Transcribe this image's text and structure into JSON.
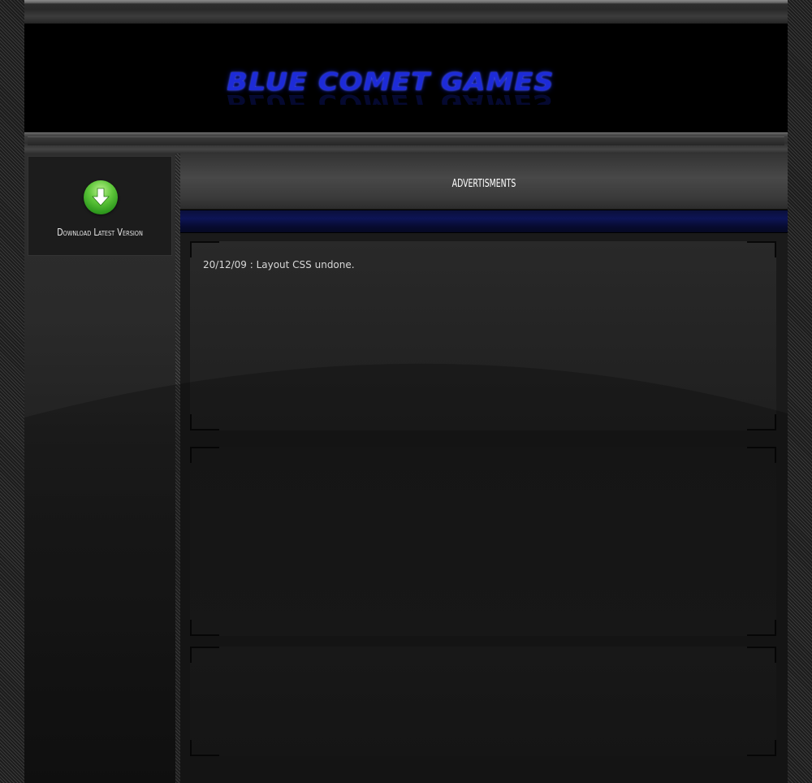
{
  "header": {
    "logo_text": "BLUE COMET GAMES"
  },
  "sidebar": {
    "download": {
      "label": "Download Latest Version",
      "icon": "download-arrow-icon",
      "icon_color": "#3fae27"
    }
  },
  "main": {
    "ad_bar": {
      "label": "ADVERTISMENTS"
    },
    "news": [
      {
        "text": "20/12/09 : Layout CSS undone."
      }
    ]
  },
  "colors": {
    "brand_blue": "#1d2bd8",
    "accent_bar": "#0d1455",
    "background": "#1b1b1b"
  }
}
